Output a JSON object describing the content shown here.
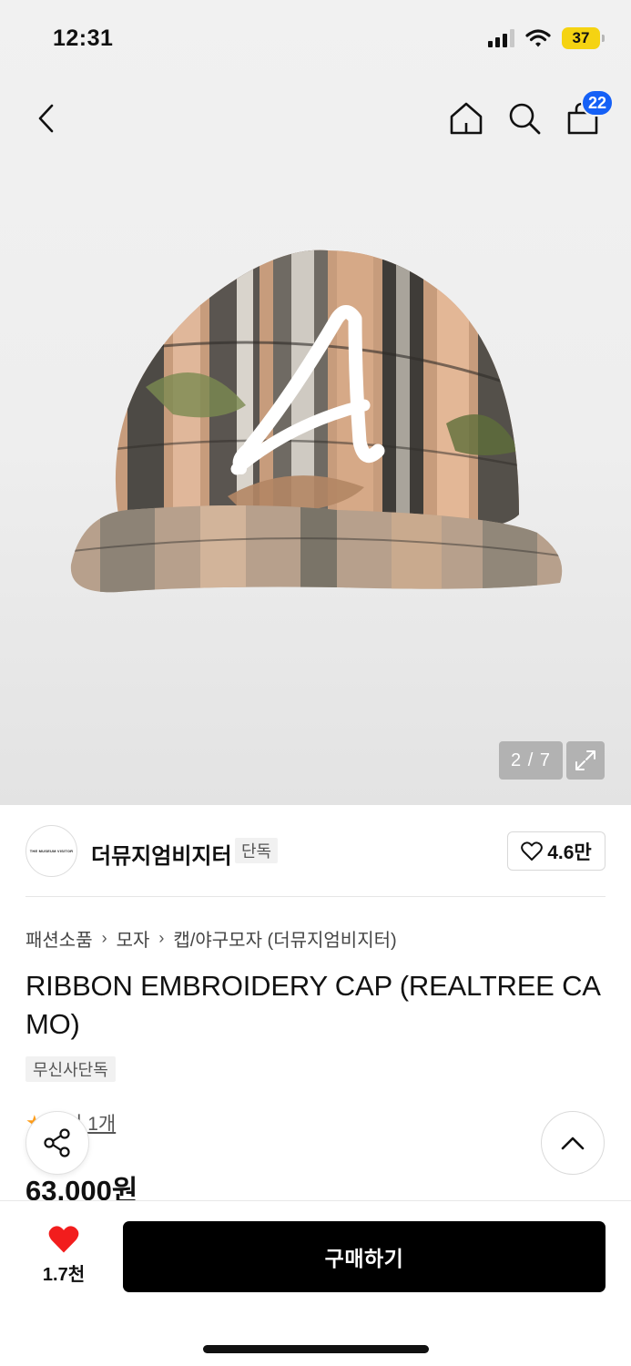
{
  "status_bar": {
    "time": "12:31",
    "battery": "37"
  },
  "nav": {
    "cart_count": "22"
  },
  "gallery": {
    "counter": "2 / 7",
    "image_letter": "A"
  },
  "brand": {
    "logo_text": "THE MUSEUM VISITOR",
    "name": "더뮤지엄비지터",
    "tag": "단독",
    "like_count": "4.6만"
  },
  "breadcrumb": [
    "패션소품",
    "모자",
    "캡/야구모자 (더뮤지엄비지터)"
  ],
  "product": {
    "title": "RIBBON EMBROIDERY CAP (REALTREE CAMO)",
    "badge": "무신사단독",
    "review": "후기 1개",
    "price": "63,000원"
  },
  "bottom_bar": {
    "wish_count": "1.7천",
    "buy_label": "구매하기"
  },
  "colors": {
    "accent": "#1560f6",
    "heart": "#f21d1d",
    "star": "#ff9e1b",
    "buy": "#000000",
    "battery": "#f5d312"
  },
  "icons": [
    "back-arrow-icon",
    "home-icon",
    "search-icon",
    "shopping-bag-icon",
    "expand-icon",
    "heart-outline-icon",
    "share-icon",
    "chevron-up-icon",
    "heart-filled-icon",
    "star-icon"
  ]
}
